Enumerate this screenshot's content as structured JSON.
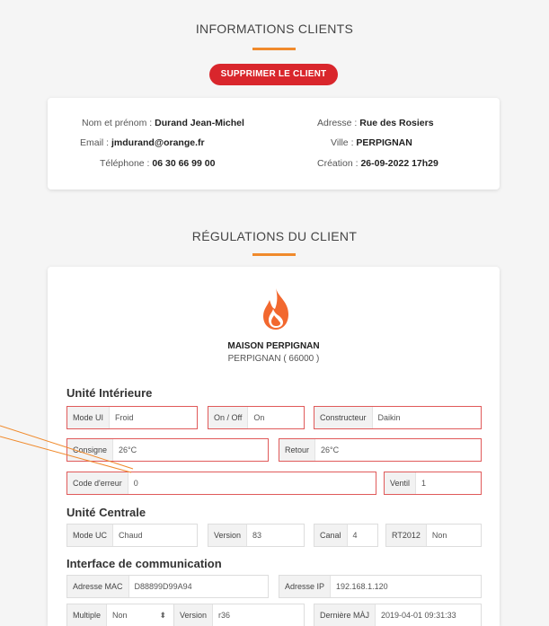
{
  "client_section": {
    "title": "INFORMATIONS CLIENTS",
    "delete_button": "SUPPRIMER LE CLIENT",
    "name_label": "Nom et prénom :",
    "name_value": "Durand Jean-Michel",
    "email_label": "Email :",
    "email_value": "jmdurand@orange.fr",
    "phone_label": "Téléphone :",
    "phone_value": "06 30 66 99 00",
    "address_label": "Adresse :",
    "address_value": "Rue des Rosiers",
    "city_label": "Ville :",
    "city_value": "PERPIGNAN",
    "created_label": "Création :",
    "created_value": "26-09-2022 17h29"
  },
  "regulation_section": {
    "title": "RÉGULATIONS DU CLIENT",
    "site_name": "MAISON PERPIGNAN",
    "site_location": "PERPIGNAN ( 66000 )",
    "icon": "flame-icon",
    "accent_color": "#f08a2c",
    "indoor": {
      "title": "Unité Intérieure",
      "mode_label": "Mode UI",
      "mode_value": "Froid",
      "onoff_label": "On / Off",
      "onoff_value": "On",
      "maker_label": "Constructeur",
      "maker_value": "Daikin",
      "setpoint_label": "Consigne",
      "setpoint_value": "26°C",
      "return_label": "Retour",
      "return_value": "26°C",
      "error_label": "Code d'erreur",
      "error_value": "0",
      "fan_label": "Ventil",
      "fan_value": "1"
    },
    "central": {
      "title": "Unité Centrale",
      "mode_label": "Mode UC",
      "mode_value": "Chaud",
      "version_label": "Version",
      "version_value": "83",
      "channel_label": "Canal",
      "channel_value": "4",
      "rt_label": "RT2012",
      "rt_value": "Non"
    },
    "comm": {
      "title": "Interface de communication",
      "mac_label": "Adresse MAC",
      "mac_value": "D88899D99A94",
      "ip_label": "Adresse IP",
      "ip_value": "192.168.1.120",
      "multiple_label": "Multiple",
      "multiple_value": "Non",
      "version_label": "Version",
      "version_value": "r36",
      "update_label": "Dernière MÀJ",
      "update_value": "2019-04-01 09:31:33"
    }
  },
  "colors": {
    "delete_button": "#d9262c",
    "error_border": "#e05a5a",
    "flame": "#f2682f"
  }
}
